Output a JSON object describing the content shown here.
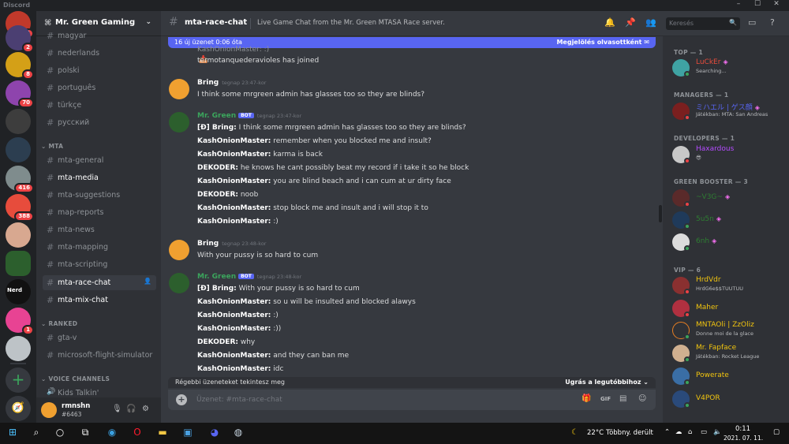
{
  "window": {
    "app_name": "Discord",
    "controls": {
      "minimize": "–",
      "maximize": "☐",
      "close": "✕"
    }
  },
  "guilds": [
    {
      "badge": "34",
      "color": "#c0392b"
    },
    {
      "badge": "2",
      "color": "#4b3f72"
    },
    {
      "badge": "8",
      "color": "#d4a017"
    },
    {
      "badge": "70",
      "color": "#8e44ad"
    },
    {
      "badge": "",
      "color": "#3d3d3d"
    },
    {
      "badge": "",
      "color": "#2c3e50"
    },
    {
      "badge": "416",
      "color": "#7f8c8d"
    },
    {
      "badge": "388",
      "color": "#e74c3c"
    },
    {
      "badge": "",
      "color": "#d8a890"
    },
    {
      "badge": "",
      "color": "#2c5f2d"
    },
    {
      "badge": "",
      "color": "#111111"
    },
    {
      "badge": "1",
      "color": "#e84393"
    },
    {
      "badge": "",
      "color": "#bdc3c7"
    }
  ],
  "guild_extras": {
    "nerd_label": "Nerd",
    "add_server": "+",
    "explore": "🧭"
  },
  "server": {
    "name": "Mr. Green Gaming"
  },
  "channels": {
    "magyar": "magyar",
    "nederlands": "nederlands",
    "polski": "polski",
    "portugues": "português",
    "turkce": "türkçe",
    "russkiy": "русский",
    "cat_mta": "MTA",
    "mta_general": "mta-general",
    "mta_media": "mta-media",
    "mta_suggestions": "mta-suggestions",
    "map_reports": "map-reports",
    "mta_news": "mta-news",
    "mta_mapping": "mta-mapping",
    "mta_scripting": "mta-scripting",
    "mta_race_chat": "mta-race-chat",
    "mta_mix_chat": "mta-mix-chat",
    "cat_ranked": "RANKED",
    "gta_v": "gta-v",
    "msfs": "microsoft-flight-simulator",
    "cat_voice": "VOICE CHANNELS",
    "kids_talkin": "Kids Talkin'"
  },
  "user": {
    "name": "rmnshn",
    "tag": "#6463"
  },
  "chat": {
    "channel": "mta-race-chat",
    "topic": "Live Game Chat from the Mr. Green MTASA Race server.",
    "new_messages": "16 új üzenet 0:06 óta",
    "mark_read": "Megjelölés olvasottként",
    "older_messages": "Régebbi üzeneteket tekintesz meg",
    "jump_latest": "Ugrás a legutóbbihoz",
    "input_placeholder": "Üzenet: #mta-race-chat",
    "bot_badge": "BOT"
  },
  "messages": {
    "cut_top": "KashOnionMaster: :)",
    "join_text": "termotanquederavioles has joined",
    "g1": {
      "author": "Bring",
      "time": "tegnap 23:47-kor",
      "text": "I think some mrgreen admin has glasses too so they are blinds?"
    },
    "g2": {
      "author": "Mr. Green",
      "time": "tegnap 23:47-kor",
      "lines": [
        {
          "who": "[Đ] Bring:",
          "text": " I think some mrgreen admin has glasses too so they are blinds?"
        },
        {
          "who": "KashOnionMaster:",
          "text": " remember when you blocked me and insult?"
        },
        {
          "who": "KashOnionMaster:",
          "text": " karma is back"
        },
        {
          "who": "DEKODER:",
          "text": " he knows he cant possibly beat my record if i take it so he block"
        },
        {
          "who": "KashOnionMaster:",
          "text": " you are blind beach and i can cum at ur dirty face"
        },
        {
          "who": "DEKODER:",
          "text": " noob"
        },
        {
          "who": "KashOnionMaster:",
          "text": " stop block me and insult and i will stop it to"
        },
        {
          "who": "KashOnionMaster:",
          "text": " :)"
        }
      ]
    },
    "g3": {
      "author": "Bring",
      "time": "tegnap 23:48-kor",
      "text": "With your pussy is so hard to cum"
    },
    "g4": {
      "author": "Mr. Green",
      "time": "tegnap 23:48-kor",
      "lines": [
        {
          "who": "[Đ] Bring:",
          "text": " With your pussy is so hard to cum"
        },
        {
          "who": "KashOnionMaster:",
          "text": " so u will be insulted and blocked alawys"
        },
        {
          "who": "KashOnionMaster:",
          "text": " :)"
        },
        {
          "who": "KashOnionMaster:",
          "text": " :))"
        },
        {
          "who": "DEKODER:",
          "text": " why"
        },
        {
          "who": "KashOnionMaster:",
          "text": " and they can ban me"
        },
        {
          "who": "KashOnionMaster:",
          "text": " idc"
        }
      ]
    }
  },
  "members": {
    "search_placeholder": "Keresés",
    "role_top": "TOP — 1",
    "role_managers": "MANAGERS — 1",
    "role_developers": "DEVELOPERS — 1",
    "role_booster": "GREEN BOOSTER — 3",
    "role_vip": "VIP — 6",
    "m_luckier": {
      "name": "LuCkEr",
      "activity": "Searching...",
      "color": "#e74c3c"
    },
    "m_mihael": {
      "name": "ミハエル | ゲス顔",
      "activity": "Játékban: MTA: San Andreas",
      "color": "#5865f2"
    },
    "m_haxardous": {
      "name": "Haxardous",
      "activity": "😎",
      "color": "#b44bff"
    },
    "m_b1": {
      "name": "~V3G~",
      "color": "#2e7d32"
    },
    "m_b2": {
      "name": "5u5n",
      "color": "#2e7d32"
    },
    "m_b3": {
      "name": "6nh",
      "color": "#2e7d32"
    },
    "m_hrdvdr": {
      "name": "HrdVdr",
      "activity": "HrdG6e$$TUUTUU",
      "color": "#f1c40f"
    },
    "m_maher": {
      "name": "Maher",
      "color": "#f1c40f"
    },
    "m_mntaoli": {
      "name": "MNTAOli | ZzOliz",
      "activity": "Donne moi de la glace",
      "color": "#f1c40f"
    },
    "m_fapface": {
      "name": "Mr. Fapface",
      "activity": "Játékban: Rocket League",
      "color": "#f1c40f"
    },
    "m_powerate": {
      "name": "Powerate",
      "color": "#f1c40f"
    },
    "m_v4por": {
      "name": "V4POR",
      "color": "#f1c40f"
    }
  },
  "taskbar": {
    "weather_temp": "22°C",
    "weather_text": "Többny. derült",
    "time": "0:11",
    "date": "2021. 07. 11."
  }
}
